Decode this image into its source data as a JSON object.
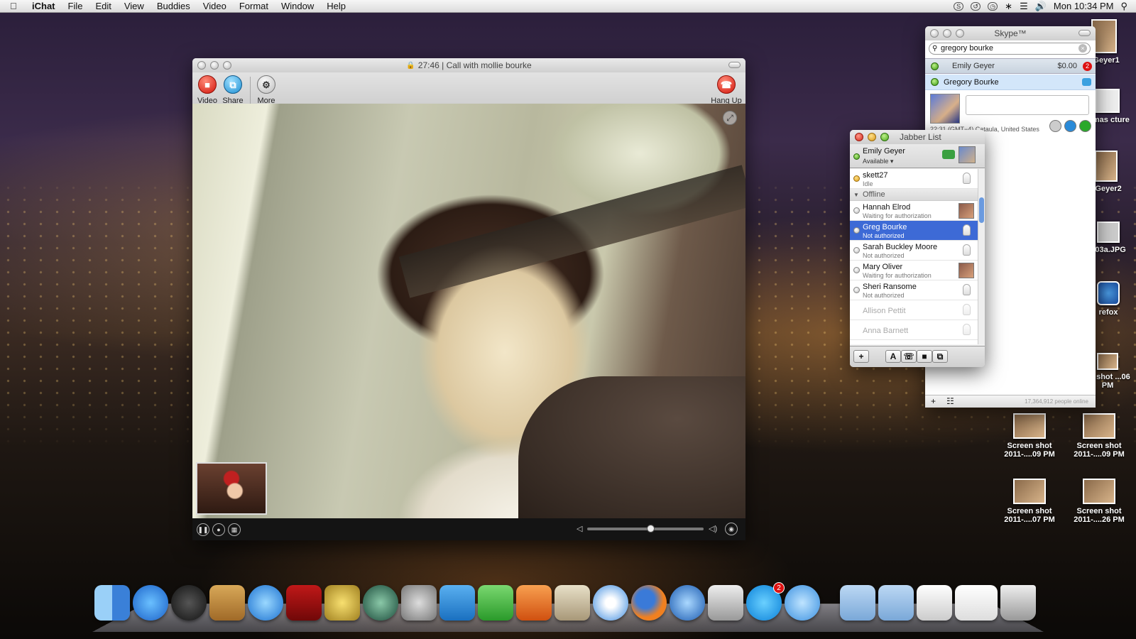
{
  "menubar": {
    "app": "iChat",
    "items": [
      "File",
      "Edit",
      "View",
      "Buddies",
      "Video",
      "Format",
      "Window",
      "Help"
    ],
    "clock": "Mon 10:34 PM"
  },
  "ichat": {
    "title": "27:46 | Call with mollie bourke",
    "toolbar": {
      "video": "Video",
      "share": "Share",
      "more": "More",
      "hangup": "Hang Up"
    }
  },
  "skype": {
    "title": "Skype™",
    "search_value": "gregory bourke",
    "me_name": "Emily Geyer",
    "balance": "$0.00",
    "badge_count": "2",
    "contact_name": "Gregory Bourke",
    "location": "22:31 (GMT−4) Cataula, United States",
    "footer_online": "17,364,912 people online",
    "footer_add": "+",
    "footer_grid": "☷"
  },
  "jabber": {
    "title": "Jabber List",
    "me_name": "Emily Geyer",
    "me_status": "Available ▾",
    "offline_group": "Offline",
    "contacts": [
      {
        "name": "skett27",
        "status": "Idle"
      },
      {
        "name": "Hannah Elrod",
        "status": "Waiting for authorization"
      },
      {
        "name": "Greg Bourke",
        "status": "Not authorized"
      },
      {
        "name": "Sarah Buckley Moore",
        "status": "Not authorized"
      },
      {
        "name": "Mary Oliver",
        "status": "Waiting for authorization"
      },
      {
        "name": "Sheri Ransome",
        "status": "Not authorized"
      },
      {
        "name": "Allison Pettit",
        "status": ""
      },
      {
        "name": "Anna Barnett",
        "status": ""
      }
    ],
    "footer": {
      "add": "+",
      "font": "A"
    }
  },
  "desktop_icons": [
    {
      "label": "yGeyer1"
    },
    {
      "label": "stmas cture"
    },
    {
      "label": "yGeyer2"
    },
    {
      "label": "203a.JPG"
    },
    {
      "label": "refox"
    },
    {
      "label": "en shot ...06 PM"
    },
    {
      "label": "Screen shot 2011-....09 PM"
    },
    {
      "label": "Screen shot 2011-....09 PM"
    },
    {
      "label": "Screen shot 2011-....07 PM"
    },
    {
      "label": "Screen shot 2011-....26 PM"
    }
  ],
  "dock": {
    "skype_badge": "2"
  }
}
